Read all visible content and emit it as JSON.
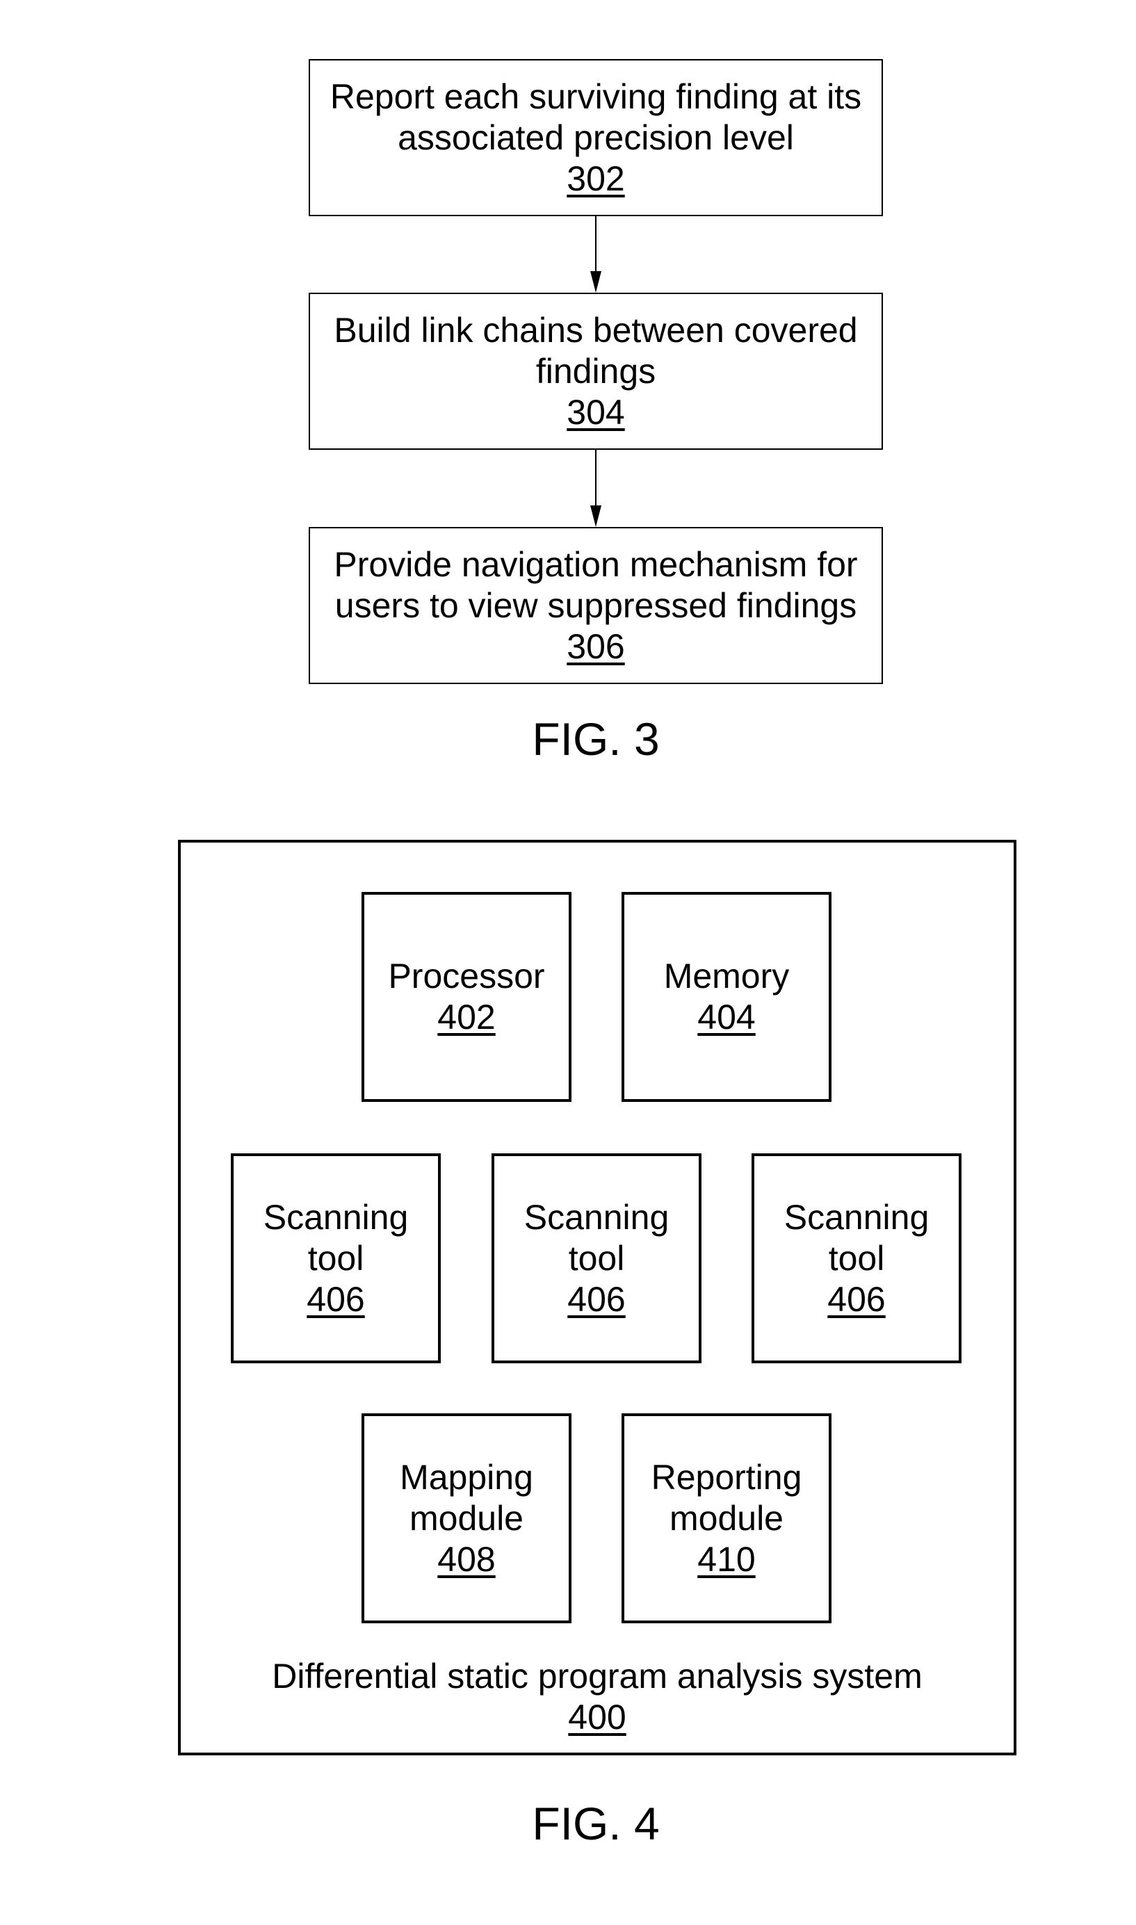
{
  "fig3": {
    "caption": "FIG. 3",
    "steps": [
      {
        "text": "Report each surviving finding at its associated precision level",
        "lines": [
          "Report each surviving finding at its",
          "associated precision level"
        ],
        "ref": "302"
      },
      {
        "text": "Build link chains between covered findings",
        "lines": [
          "Build link chains between covered",
          "findings"
        ],
        "ref": "304"
      },
      {
        "text": "Provide navigation mechanism for users to view suppressed findings",
        "lines": [
          "Provide navigation mechanism for",
          "users to view suppressed findings"
        ],
        "ref": "306"
      }
    ]
  },
  "fig4": {
    "caption": "FIG. 4",
    "system": {
      "label": "Differential static program analysis system",
      "ref": "400"
    },
    "components": [
      {
        "lines": [
          "Processor"
        ],
        "ref": "402"
      },
      {
        "lines": [
          "Memory"
        ],
        "ref": "404"
      },
      {
        "lines": [
          "Scanning",
          "tool"
        ],
        "ref": "406"
      },
      {
        "lines": [
          "Scanning",
          "tool"
        ],
        "ref": "406"
      },
      {
        "lines": [
          "Scanning",
          "tool"
        ],
        "ref": "406"
      },
      {
        "lines": [
          "Mapping",
          "module"
        ],
        "ref": "408"
      },
      {
        "lines": [
          "Reporting",
          "module"
        ],
        "ref": "410"
      }
    ]
  }
}
